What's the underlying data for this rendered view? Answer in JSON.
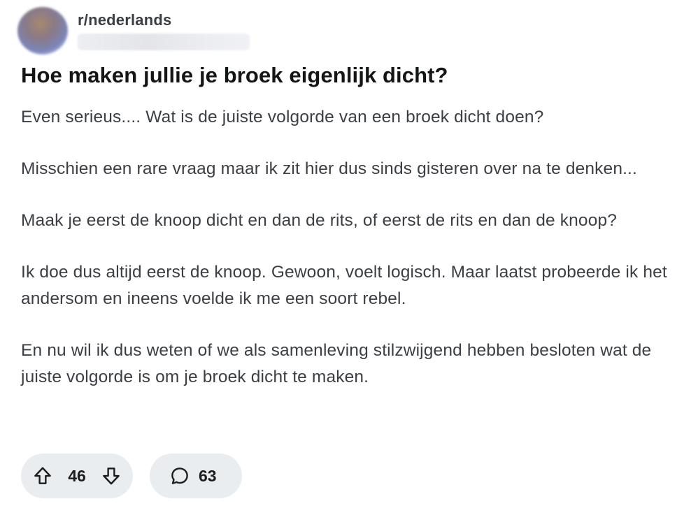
{
  "post": {
    "subreddit": "r/nederlands",
    "title": "Hoe maken jullie je broek eigenlijk dicht?",
    "paragraphs": [
      "Even serieus.... Wat is de juiste volgorde van een broek dicht doen?",
      "Misschien een rare vraag maar ik zit hier dus sinds gisteren over na te denken...",
      "Maak je eerst de knoop dicht en dan de rits, of eerst de rits en dan de knoop?",
      "Ik doe dus altijd eerst de knoop. Gewoon, voelt logisch. Maar laatst probeerde ik het andersom en ineens voelde ik me een soort rebel.",
      "En nu wil ik dus weten of we als samenleving stilzwijgend hebben besloten wat de juiste volgorde is om je broek dicht te maken."
    ]
  },
  "actions": {
    "vote_count": "46",
    "comment_count": "63",
    "upvote_icon": "arrow-up-outline-icon",
    "downvote_icon": "arrow-down-outline-icon",
    "comment_icon": "speech-bubble-icon"
  },
  "colors": {
    "pill_background": "#eaedef",
    "title_text": "#131516",
    "body_text": "#3b3f44"
  }
}
